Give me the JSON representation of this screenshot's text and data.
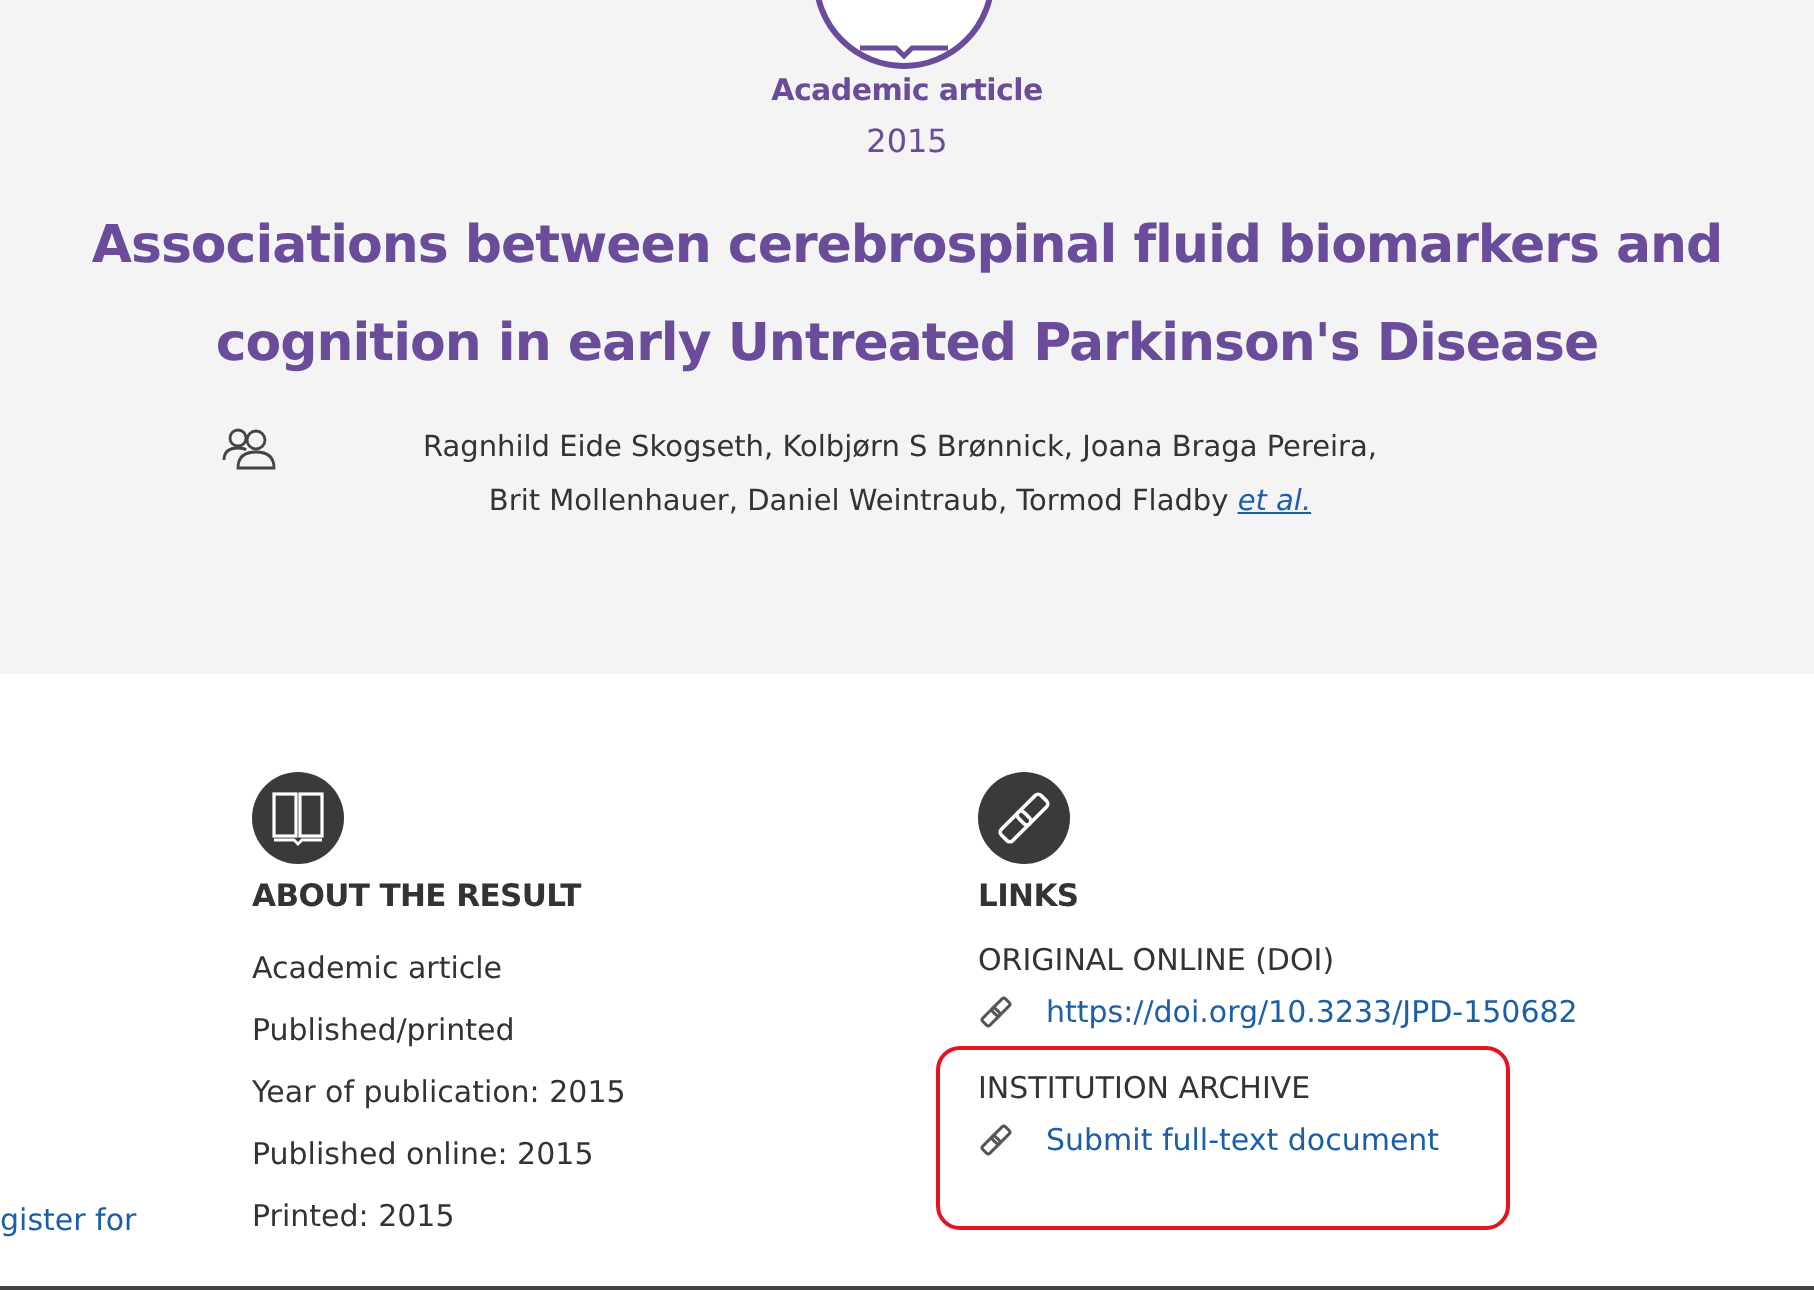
{
  "header": {
    "type_label": "Academic article",
    "year": "2015",
    "title": "Associations between cerebrospinal fluid biomarkers and cognition in early Untreated Parkinson's Disease",
    "authors_line_1": "Ragnhild Eide Skogseth, Kolbjørn S Brønnick, Joana Braga Pereira,",
    "authors_line_2": "Brit Mollenhauer, Daniel Weintraub, Tormod Fladby",
    "more_authors_link": "et al."
  },
  "side_link": "gister for",
  "about": {
    "heading": "ABOUT THE RESULT",
    "items": [
      "Academic article",
      "Published/printed",
      "Year of publication: 2015",
      "Published online: 2015",
      "Printed: 2015"
    ]
  },
  "links": {
    "heading": "LINKS",
    "groups": [
      {
        "label": "ORIGINAL ONLINE (DOI)",
        "link": "https://doi.org/10.3233/JPD-150682",
        "highlighted": false
      },
      {
        "label": "INSTITUTION ARCHIVE",
        "link": "Submit full-text document",
        "highlighted": true
      }
    ]
  }
}
